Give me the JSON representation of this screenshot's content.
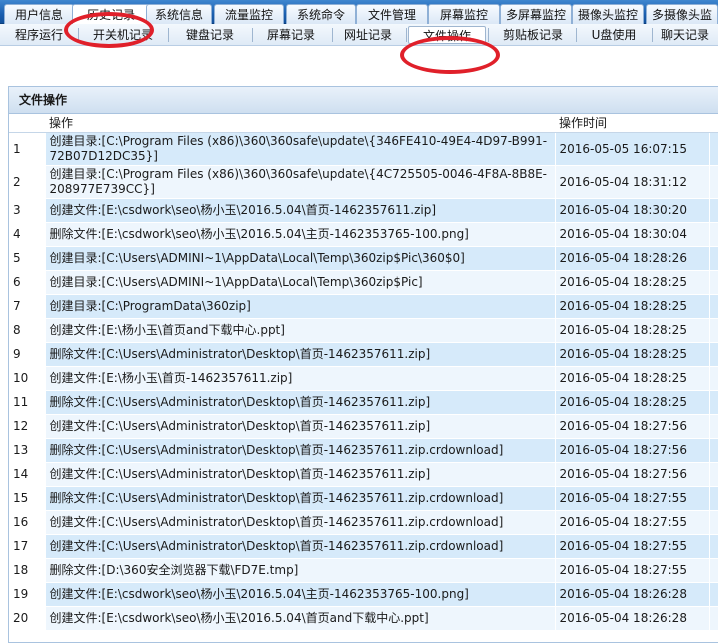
{
  "top_tabs": [
    {
      "label": "用户信息",
      "active": false
    },
    {
      "label": "历史记录",
      "active": true
    },
    {
      "label": "系统信息",
      "active": false
    },
    {
      "label": "流量监控",
      "active": false
    },
    {
      "label": "系统命令",
      "active": false
    },
    {
      "label": "文件管理",
      "active": false
    },
    {
      "label": "屏幕监控",
      "active": false
    },
    {
      "label": "多屏幕监控",
      "active": false
    },
    {
      "label": "摄像头监控",
      "active": false
    },
    {
      "label": "多摄像头监",
      "active": false
    }
  ],
  "sub_tabs": [
    {
      "label": "程序运行",
      "active": false
    },
    {
      "label": "开关机记录",
      "active": false
    },
    {
      "label": "键盘记录",
      "active": false
    },
    {
      "label": "屏幕记录",
      "active": false
    },
    {
      "label": "网址记录",
      "active": false
    },
    {
      "label": "文件操作",
      "active": true
    },
    {
      "label": "剪贴板记录",
      "active": false
    },
    {
      "label": "U盘使用",
      "active": false
    },
    {
      "label": "聊天记录",
      "active": false
    }
  ],
  "panel": {
    "title": "文件操作",
    "columns": {
      "index": "",
      "operation": "操作",
      "time": "操作时间"
    },
    "rows": [
      {
        "index": "1",
        "operation": "创建目录:[C:\\Program Files (x86)\\360\\360safe\\update\\{346FE410-49E4-4D97-B991-72B07D12DC35}]",
        "time": "2016-05-05 16:07:15"
      },
      {
        "index": "2",
        "operation": "创建目录:[C:\\Program Files (x86)\\360\\360safe\\update\\{4C725505-0046-4F8A-8B8E-208977E739CC}]",
        "time": "2016-05-04 18:31:12"
      },
      {
        "index": "3",
        "operation": "创建文件:[E:\\csdwork\\seo\\杨小玉\\2016.5.04\\首页-1462357611.zip]",
        "time": "2016-05-04 18:30:20"
      },
      {
        "index": "4",
        "operation": "删除文件:[E:\\csdwork\\seo\\杨小玉\\2016.5.04\\主页-1462353765-100.png]",
        "time": "2016-05-04 18:30:04"
      },
      {
        "index": "5",
        "operation": "创建目录:[C:\\Users\\ADMINI~1\\AppData\\Local\\Temp\\360zip$Pic\\360$0]",
        "time": "2016-05-04 18:28:26"
      },
      {
        "index": "6",
        "operation": "创建目录:[C:\\Users\\ADMINI~1\\AppData\\Local\\Temp\\360zip$Pic]",
        "time": "2016-05-04 18:28:25"
      },
      {
        "index": "7",
        "operation": "创建目录:[C:\\ProgramData\\360zip]",
        "time": "2016-05-04 18:28:25"
      },
      {
        "index": "8",
        "operation": "创建文件:[E:\\杨小玉\\首页and下载中心.ppt]",
        "time": "2016-05-04 18:28:25"
      },
      {
        "index": "9",
        "operation": "删除文件:[C:\\Users\\Administrator\\Desktop\\首页-1462357611.zip]",
        "time": "2016-05-04 18:28:25"
      },
      {
        "index": "10",
        "operation": "创建文件:[E:\\杨小玉\\首页-1462357611.zip]",
        "time": "2016-05-04 18:28:25"
      },
      {
        "index": "11",
        "operation": "删除文件:[C:\\Users\\Administrator\\Desktop\\首页-1462357611.zip]",
        "time": "2016-05-04 18:28:25"
      },
      {
        "index": "12",
        "operation": "创建文件:[C:\\Users\\Administrator\\Desktop\\首页-1462357611.zip]",
        "time": "2016-05-04 18:27:56"
      },
      {
        "index": "13",
        "operation": "删除文件:[C:\\Users\\Administrator\\Desktop\\首页-1462357611.zip.crdownload]",
        "time": "2016-05-04 18:27:56"
      },
      {
        "index": "14",
        "operation": "创建文件:[C:\\Users\\Administrator\\Desktop\\首页-1462357611.zip]",
        "time": "2016-05-04 18:27:56"
      },
      {
        "index": "15",
        "operation": "删除文件:[C:\\Users\\Administrator\\Desktop\\首页-1462357611.zip.crdownload]",
        "time": "2016-05-04 18:27:55"
      },
      {
        "index": "16",
        "operation": "创建文件:[C:\\Users\\Administrator\\Desktop\\首页-1462357611.zip.crdownload]",
        "time": "2016-05-04 18:27:55"
      },
      {
        "index": "17",
        "operation": "创建文件:[C:\\Users\\Administrator\\Desktop\\首页-1462357611.zip.crdownload]",
        "time": "2016-05-04 18:27:55"
      },
      {
        "index": "18",
        "operation": "删除文件:[D:\\360安全浏览器下载\\FD7E.tmp]",
        "time": "2016-05-04 18:27:55"
      },
      {
        "index": "19",
        "operation": "创建文件:[E:\\csdwork\\seo\\杨小玉\\2016.5.04\\主页-1462353765-100.png]",
        "time": "2016-05-04 18:26:28"
      },
      {
        "index": "20",
        "operation": "创建文件:[E:\\csdwork\\seo\\杨小玉\\2016.5.04\\首页and下载中心.ppt]",
        "time": "2016-05-04 18:26:28"
      }
    ]
  },
  "colors": {
    "highlight": "#e0202a",
    "row_odd": "#d6eafa",
    "row_even": "#eef6fd",
    "tab_bar": "#1a5fb0"
  }
}
